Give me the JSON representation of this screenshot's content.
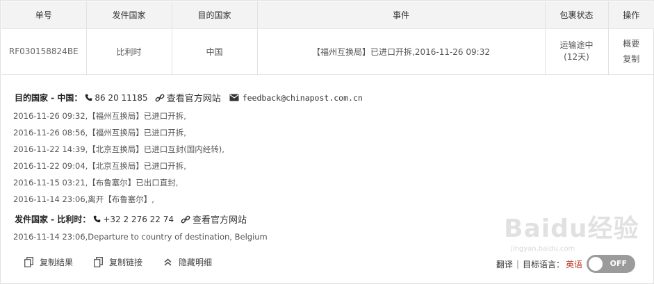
{
  "table": {
    "headers": [
      "单号",
      "发件国家",
      "目的国家",
      "事件",
      "包裹状态",
      "操作"
    ],
    "row": {
      "tracking_number": "RF030158824BE",
      "origin_country": "比利时",
      "destination_country": "中国",
      "event": "【福州互换局】已进口开拆,2016-11-26 09:32",
      "status_line1": "运输途中",
      "status_line2": "(12天)",
      "op_summary": "概要",
      "op_copy": "复制"
    }
  },
  "destination": {
    "heading": "目的国家 - 中国：",
    "phone": "86 20 11185",
    "website_label": "查看官方网站",
    "email": "feedback@chinapost.com.cn",
    "events": [
      "2016-11-26 09:32,【福州互换局】已进口开拆,",
      "2016-11-26 08:56,【福州互换局】已进口开拆,",
      "2016-11-22 14:39,【北京互换局】已进口互封(国内经转),",
      "2016-11-22 09:04,【北京互换局】已进口开拆,",
      "2016-11-15 03:21,【布鲁塞尔】已出口直封,",
      "2016-11-14 23:06,离开【布鲁塞尔】,"
    ]
  },
  "origin": {
    "heading": "发件国家 - 比利时：",
    "phone": "+32 2 276 22 74",
    "website_label": "查看官方网站",
    "events": [
      "2016-11-14 23:06,Departure to country of destination, Belgium"
    ]
  },
  "actions": {
    "copy_result": "复制结果",
    "copy_link": "复制链接",
    "hide_details": "隐藏明细"
  },
  "translate": {
    "label": "翻译",
    "separator": "|",
    "target_label": "目标语言：",
    "target_lang": "英语",
    "toggle_text": "OFF"
  },
  "watermark": {
    "text": "Baidu经验",
    "sub": "jingyan.baidu.com"
  }
}
